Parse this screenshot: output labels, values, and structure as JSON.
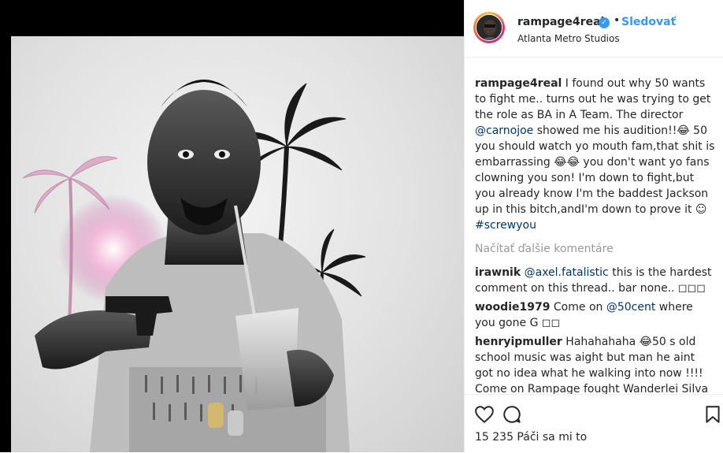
{
  "post": {
    "username": "rampage4real",
    "follow_label": "Sledovať",
    "separator": "•",
    "location": "Atlanta Metro Studios"
  },
  "caption": {
    "username": "rampage4real",
    "text_1": " I found out why 50 wants to fight me.. turns out he was trying to get the role as BA in A Team. The director ",
    "mention": "@carnojoe",
    "text_2": " showed me his audition!!😂 50 you should watch yo mouth fam,that shit is embarrassing 😂😂 you don't want yo fans clowning you son! I'm down to fight,but you already know I'm the baddest Jackson up in this bitch,andI'm down to prove it ☺",
    "hashtag": "#screwyou"
  },
  "load_more": "Načítať ďalšie komentáre",
  "comments": [
    {
      "username": "irawnik",
      "mention": "@axel.fatalistic",
      "text": " this is the hardest comment on this thread.. bar none.. ◻◻◻"
    },
    {
      "username": "woodie1979",
      "pre": " Come on ",
      "mention": "@50cent",
      "text": " where you gone G ◻◻"
    },
    {
      "username": "henryipmuller",
      "text": " Hahahahaha 😂50 s old school music was aight but man he aint got no idea what he walking into now !!!! Come on Rampage fought Wanderlei Silva"
    }
  ],
  "footer": {
    "likes": "15 235 Páči sa mi to"
  },
  "icons": [
    "verified-badge-icon",
    "heart-icon",
    "comment-icon",
    "bookmark-icon"
  ],
  "colors": {
    "link": "#3897f0",
    "mention": "#003569",
    "verified": "#3897f0"
  }
}
